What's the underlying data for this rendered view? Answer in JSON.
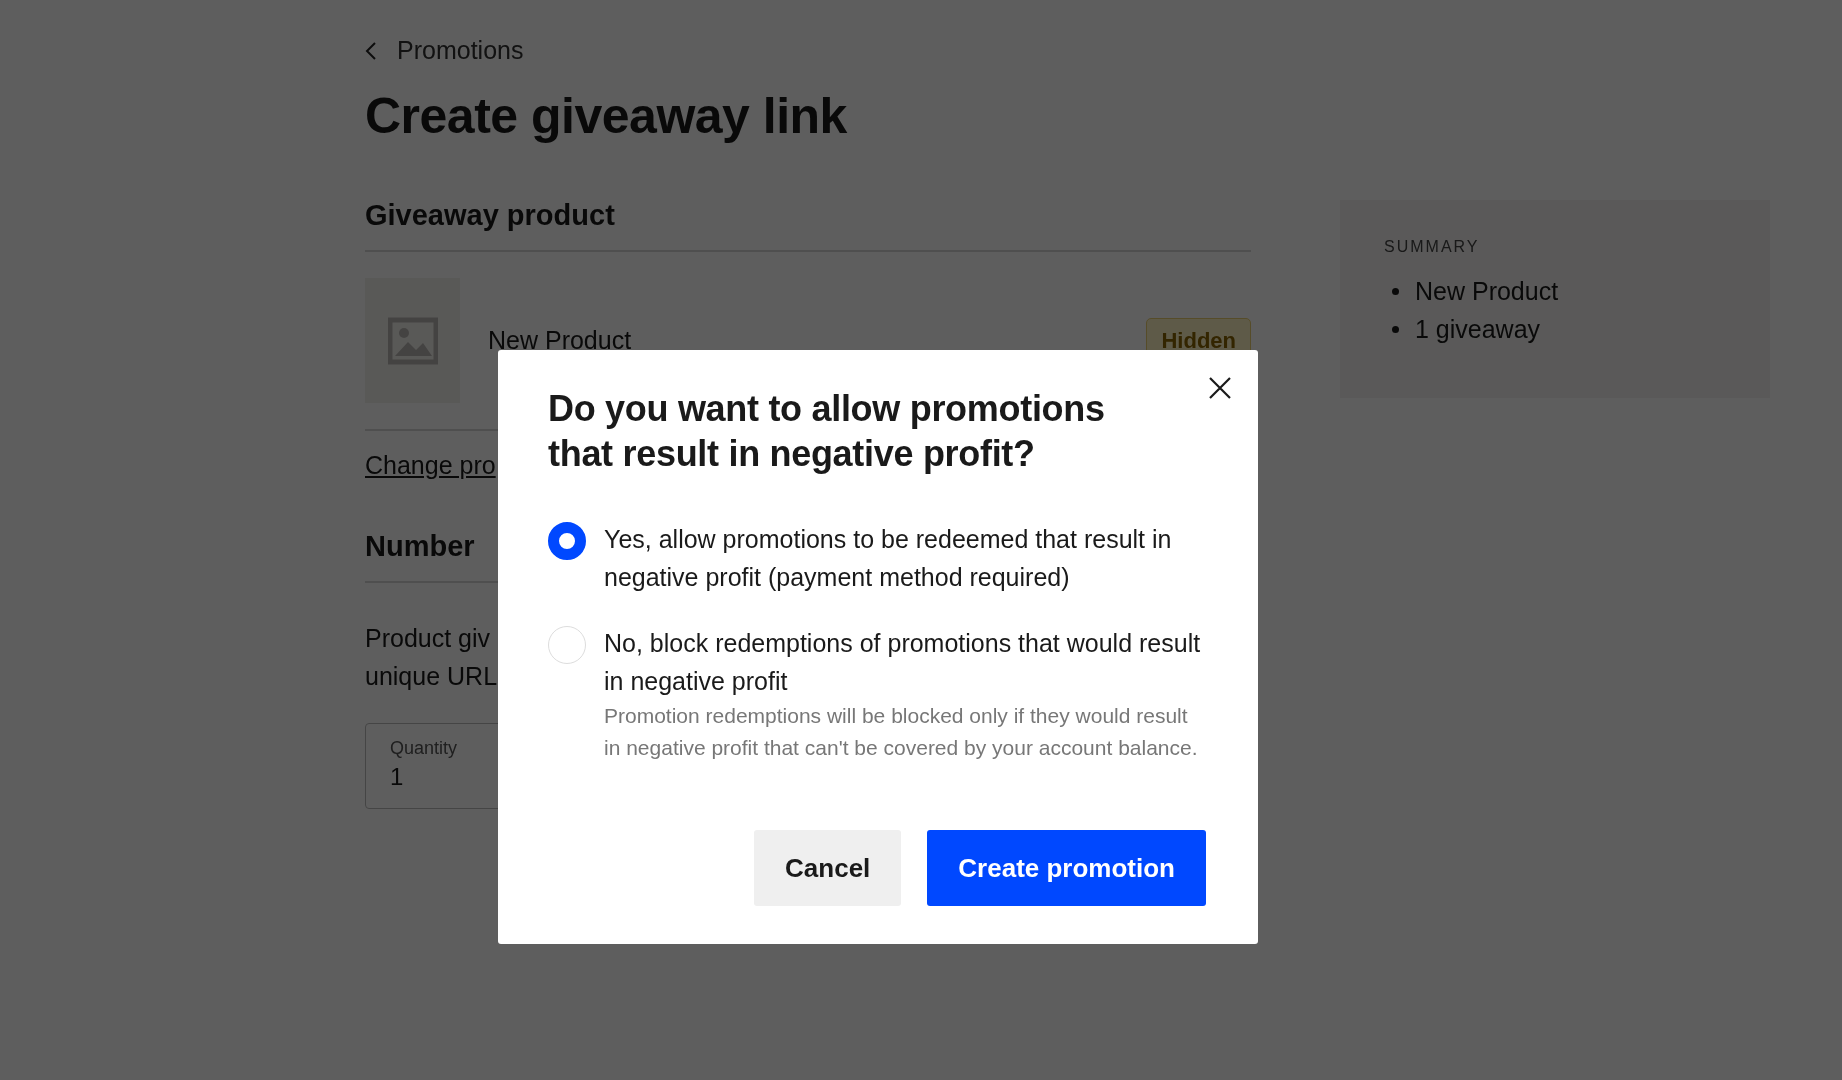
{
  "breadcrumb": {
    "label": "Promotions"
  },
  "page_title": "Create giveaway link",
  "giveaway_product": {
    "heading": "Giveaway product",
    "product_name": "New Product",
    "status_badge": "Hidden",
    "change_link": "Change pro"
  },
  "number_section": {
    "heading": "Number",
    "description_lines": [
      "Product giv",
      "unique URL"
    ],
    "quantity": {
      "label": "Quantity",
      "value": "1"
    }
  },
  "summary": {
    "heading": "SUMMARY",
    "items": [
      "New Product",
      "1 giveaway"
    ]
  },
  "dialog": {
    "title": "Do you want to allow promotions that result in negative profit?",
    "options": [
      {
        "label": "Yes, allow promotions to be redeemed that result in negative profit (payment method required)",
        "selected": true
      },
      {
        "label": "No, block redemptions of promotions that would result in negative profit",
        "help": "Promotion redemptions will be blocked only if they would result in negative profit that can't be covered by your account balance.",
        "selected": false
      }
    ],
    "buttons": [
      {
        "label": "Cancel",
        "kind": "secondary"
      },
      {
        "label": "Create promotion",
        "kind": "primary"
      }
    ]
  }
}
